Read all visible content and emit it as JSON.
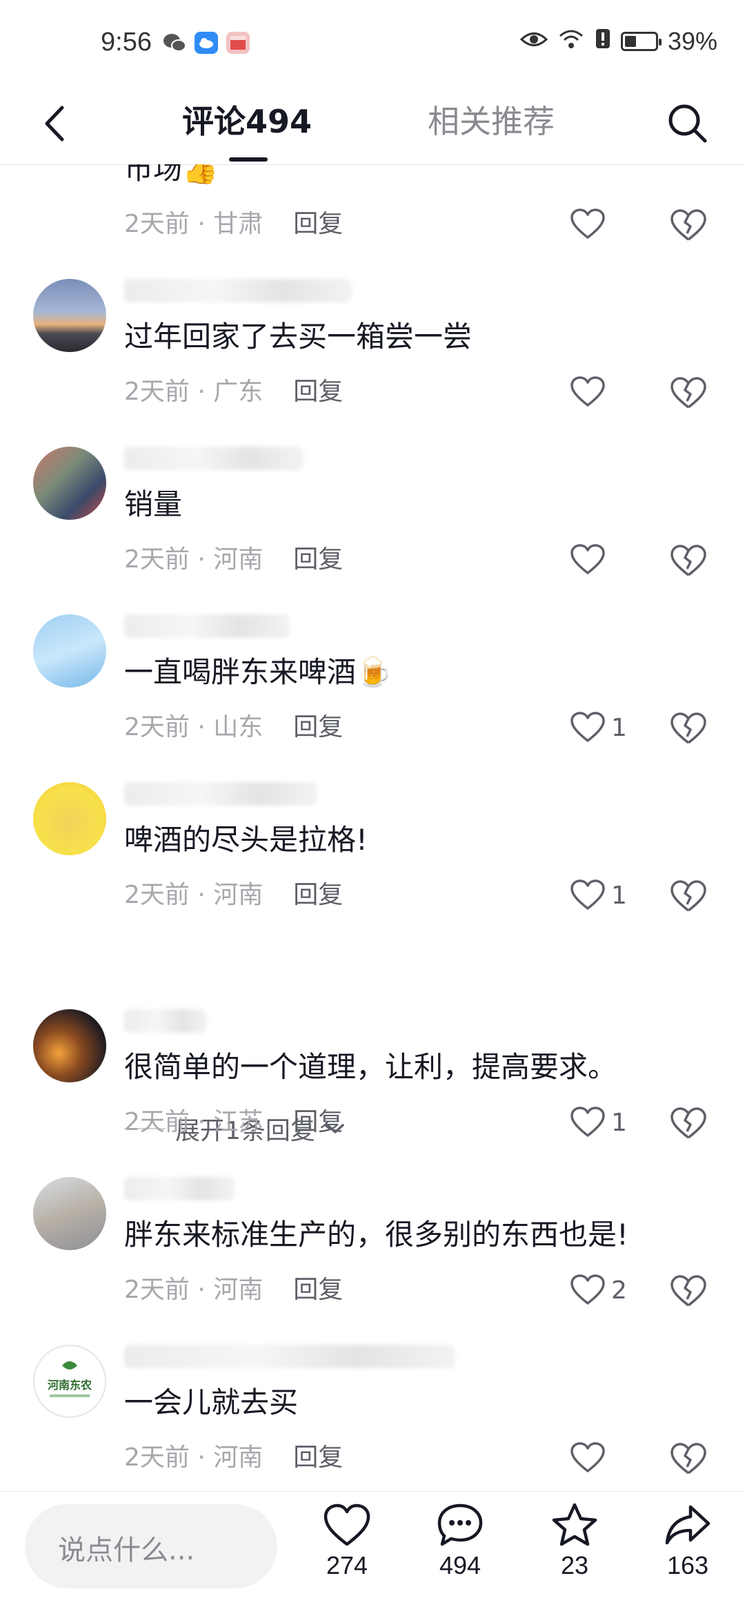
{
  "status_bar": {
    "time": "9:56",
    "battery": "39%",
    "battery_level": 0.39
  },
  "nav": {
    "tab_comments": "评论494",
    "tab_related": "相关推荐"
  },
  "partial_comment": {
    "text": "市场👍",
    "time": "2天前",
    "sep": " · ",
    "location": "甘肃",
    "reply": "回复",
    "likes": ""
  },
  "comments": [
    {
      "text": "过年回家了去买一箱尝一尝",
      "time": "2天前",
      "location": "广东",
      "reply": "回复",
      "likes": ""
    },
    {
      "text": "销量",
      "time": "2天前",
      "location": "河南",
      "reply": "回复",
      "likes": ""
    },
    {
      "text": "一直喝胖东来啤酒🍺",
      "time": "2天前",
      "location": "山东",
      "reply": "回复",
      "likes": "1"
    },
    {
      "text": "啤酒的尽头是拉格!",
      "time": "2天前",
      "location": "河南",
      "reply": "回复",
      "likes": "1"
    },
    {
      "text": "很简单的一个道理，让利，提高要求。",
      "time": "2天前",
      "location": "江苏",
      "reply": "回复",
      "likes": "1"
    },
    {
      "text": "胖东来标准生产的，很多别的东西也是!",
      "time": "2天前",
      "location": "河南",
      "reply": "回复",
      "likes": "2"
    },
    {
      "text": "一会儿就去买",
      "time": "2天前",
      "location": "河南",
      "reply": "回复",
      "likes": ""
    }
  ],
  "sep": " · ",
  "expand_replies": "展开1条回复",
  "avatar_logo_text": "河南东农",
  "bottom": {
    "placeholder": "说点什么...",
    "likes": "274",
    "comments": "494",
    "favorites": "23",
    "shares": "163"
  }
}
